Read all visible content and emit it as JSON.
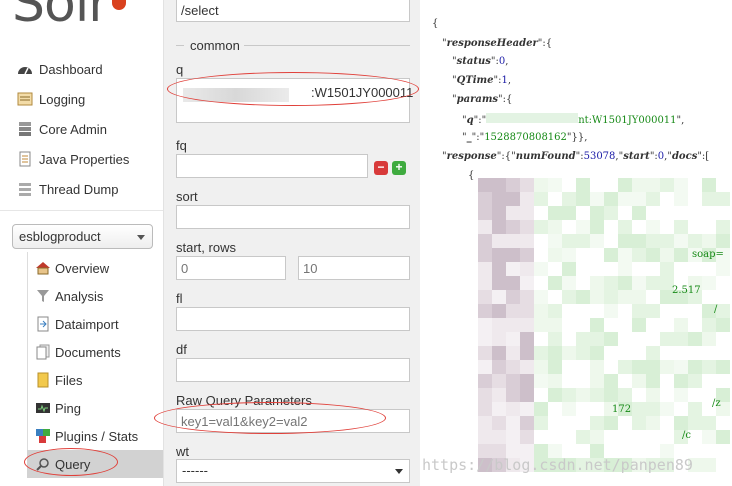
{
  "brand": {
    "logo_text": "Solr"
  },
  "sidebar": {
    "nav": [
      {
        "label": "Dashboard",
        "icon": "dashboard-icon"
      },
      {
        "label": "Logging",
        "icon": "logging-icon"
      },
      {
        "label": "Core Admin",
        "icon": "core-admin-icon"
      },
      {
        "label": "Java Properties",
        "icon": "java-properties-icon"
      },
      {
        "label": "Thread Dump",
        "icon": "thread-dump-icon"
      }
    ],
    "core_selector": "esblogproduct",
    "core_menu": [
      {
        "label": "Overview",
        "icon": "overview-icon"
      },
      {
        "label": "Analysis",
        "icon": "analysis-icon"
      },
      {
        "label": "Dataimport",
        "icon": "dataimport-icon"
      },
      {
        "label": "Documents",
        "icon": "documents-icon"
      },
      {
        "label": "Files",
        "icon": "files-icon"
      },
      {
        "label": "Ping",
        "icon": "ping-icon"
      },
      {
        "label": "Plugins / Stats",
        "icon": "plugins-icon"
      },
      {
        "label": "Query",
        "icon": "query-icon",
        "active": true
      }
    ]
  },
  "query_form": {
    "handler": "/select",
    "section_common": "common",
    "q_label": "q",
    "q_value_visible": ":W1501JY000011",
    "fq_label": "fq",
    "fq_value": "",
    "sort_label": "sort",
    "sort_value": "",
    "start_rows_label": "start, rows",
    "start_placeholder": "0",
    "rows_placeholder": "10",
    "fl_label": "fl",
    "fl_value": "",
    "df_label": "df",
    "df_value": "",
    "raw_params_label": "Raw Query Parameters",
    "raw_params_placeholder": "key1=val1&key2=val2",
    "wt_label": "wt",
    "wt_value": "------",
    "colors": {
      "annotation": "#e0403a",
      "remove": "#d83a3a",
      "add": "#3fab3f"
    }
  },
  "response": {
    "open_brace": "{",
    "responseHeader_key": "responseHeader",
    "status_key": "status",
    "status_value": "0",
    "qtime_key": "QTime",
    "qtime_value": "1",
    "params_key": "params",
    "q_key": "q",
    "q_value_visible": "nt:W1501JY000011",
    "underscore_key": "_",
    "underscore_value": "1528870808162",
    "response_key": "response",
    "numfound_key": "numFound",
    "numfound_value": "53078",
    "start_key": "start",
    "start_value": "0",
    "docs_key": "docs",
    "doc_open": "{",
    "fragments": [
      "soap=",
      "2.517",
      "/",
      "/z",
      "172",
      "/c"
    ]
  },
  "watermark": "https://blog.csdn.net/panpen89"
}
